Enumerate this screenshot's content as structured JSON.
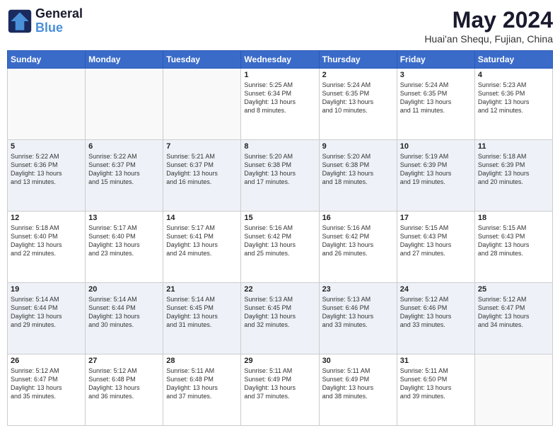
{
  "header": {
    "logo_line1": "General",
    "logo_line2": "Blue",
    "main_title": "May 2024",
    "subtitle": "Huai'an Shequ, Fujian, China"
  },
  "days_of_week": [
    "Sunday",
    "Monday",
    "Tuesday",
    "Wednesday",
    "Thursday",
    "Friday",
    "Saturday"
  ],
  "weeks": [
    [
      {
        "day": "",
        "info": ""
      },
      {
        "day": "",
        "info": ""
      },
      {
        "day": "",
        "info": ""
      },
      {
        "day": "1",
        "info": "Sunrise: 5:25 AM\nSunset: 6:34 PM\nDaylight: 13 hours\nand 8 minutes."
      },
      {
        "day": "2",
        "info": "Sunrise: 5:24 AM\nSunset: 6:35 PM\nDaylight: 13 hours\nand 10 minutes."
      },
      {
        "day": "3",
        "info": "Sunrise: 5:24 AM\nSunset: 6:35 PM\nDaylight: 13 hours\nand 11 minutes."
      },
      {
        "day": "4",
        "info": "Sunrise: 5:23 AM\nSunset: 6:36 PM\nDaylight: 13 hours\nand 12 minutes."
      }
    ],
    [
      {
        "day": "5",
        "info": "Sunrise: 5:22 AM\nSunset: 6:36 PM\nDaylight: 13 hours\nand 13 minutes."
      },
      {
        "day": "6",
        "info": "Sunrise: 5:22 AM\nSunset: 6:37 PM\nDaylight: 13 hours\nand 15 minutes."
      },
      {
        "day": "7",
        "info": "Sunrise: 5:21 AM\nSunset: 6:37 PM\nDaylight: 13 hours\nand 16 minutes."
      },
      {
        "day": "8",
        "info": "Sunrise: 5:20 AM\nSunset: 6:38 PM\nDaylight: 13 hours\nand 17 minutes."
      },
      {
        "day": "9",
        "info": "Sunrise: 5:20 AM\nSunset: 6:38 PM\nDaylight: 13 hours\nand 18 minutes."
      },
      {
        "day": "10",
        "info": "Sunrise: 5:19 AM\nSunset: 6:39 PM\nDaylight: 13 hours\nand 19 minutes."
      },
      {
        "day": "11",
        "info": "Sunrise: 5:18 AM\nSunset: 6:39 PM\nDaylight: 13 hours\nand 20 minutes."
      }
    ],
    [
      {
        "day": "12",
        "info": "Sunrise: 5:18 AM\nSunset: 6:40 PM\nDaylight: 13 hours\nand 22 minutes."
      },
      {
        "day": "13",
        "info": "Sunrise: 5:17 AM\nSunset: 6:40 PM\nDaylight: 13 hours\nand 23 minutes."
      },
      {
        "day": "14",
        "info": "Sunrise: 5:17 AM\nSunset: 6:41 PM\nDaylight: 13 hours\nand 24 minutes."
      },
      {
        "day": "15",
        "info": "Sunrise: 5:16 AM\nSunset: 6:42 PM\nDaylight: 13 hours\nand 25 minutes."
      },
      {
        "day": "16",
        "info": "Sunrise: 5:16 AM\nSunset: 6:42 PM\nDaylight: 13 hours\nand 26 minutes."
      },
      {
        "day": "17",
        "info": "Sunrise: 5:15 AM\nSunset: 6:43 PM\nDaylight: 13 hours\nand 27 minutes."
      },
      {
        "day": "18",
        "info": "Sunrise: 5:15 AM\nSunset: 6:43 PM\nDaylight: 13 hours\nand 28 minutes."
      }
    ],
    [
      {
        "day": "19",
        "info": "Sunrise: 5:14 AM\nSunset: 6:44 PM\nDaylight: 13 hours\nand 29 minutes."
      },
      {
        "day": "20",
        "info": "Sunrise: 5:14 AM\nSunset: 6:44 PM\nDaylight: 13 hours\nand 30 minutes."
      },
      {
        "day": "21",
        "info": "Sunrise: 5:14 AM\nSunset: 6:45 PM\nDaylight: 13 hours\nand 31 minutes."
      },
      {
        "day": "22",
        "info": "Sunrise: 5:13 AM\nSunset: 6:45 PM\nDaylight: 13 hours\nand 32 minutes."
      },
      {
        "day": "23",
        "info": "Sunrise: 5:13 AM\nSunset: 6:46 PM\nDaylight: 13 hours\nand 33 minutes."
      },
      {
        "day": "24",
        "info": "Sunrise: 5:12 AM\nSunset: 6:46 PM\nDaylight: 13 hours\nand 33 minutes."
      },
      {
        "day": "25",
        "info": "Sunrise: 5:12 AM\nSunset: 6:47 PM\nDaylight: 13 hours\nand 34 minutes."
      }
    ],
    [
      {
        "day": "26",
        "info": "Sunrise: 5:12 AM\nSunset: 6:47 PM\nDaylight: 13 hours\nand 35 minutes."
      },
      {
        "day": "27",
        "info": "Sunrise: 5:12 AM\nSunset: 6:48 PM\nDaylight: 13 hours\nand 36 minutes."
      },
      {
        "day": "28",
        "info": "Sunrise: 5:11 AM\nSunset: 6:48 PM\nDaylight: 13 hours\nand 37 minutes."
      },
      {
        "day": "29",
        "info": "Sunrise: 5:11 AM\nSunset: 6:49 PM\nDaylight: 13 hours\nand 37 minutes."
      },
      {
        "day": "30",
        "info": "Sunrise: 5:11 AM\nSunset: 6:49 PM\nDaylight: 13 hours\nand 38 minutes."
      },
      {
        "day": "31",
        "info": "Sunrise: 5:11 AM\nSunset: 6:50 PM\nDaylight: 13 hours\nand 39 minutes."
      },
      {
        "day": "",
        "info": ""
      }
    ]
  ]
}
